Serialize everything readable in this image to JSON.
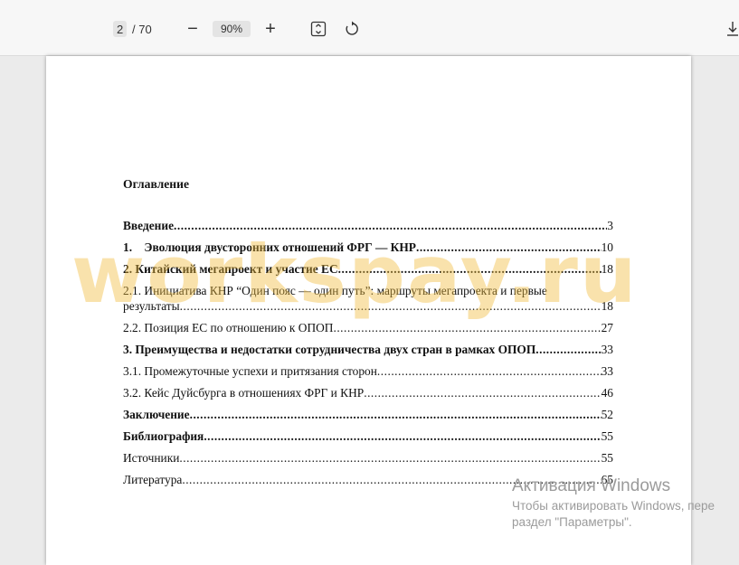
{
  "toolbar": {
    "current_page": "2",
    "total_pages": "/ 70",
    "zoom_out_glyph": "−",
    "zoom_level": "90%",
    "zoom_in_glyph": "+",
    "icons": [
      "fit-page-icon",
      "rotate-icon",
      "download-icon"
    ]
  },
  "document": {
    "heading": "Оглавление",
    "toc": [
      {
        "label": "Введение",
        "page": "3",
        "bold": true
      },
      {
        "label": "1.    Эволюция двусторонних отношений ФРГ — КНР",
        "page": "10",
        "bold": true
      },
      {
        "label": "2. Китайский мегапроект и участие ЕС",
        "page": "18",
        "bold": true
      },
      {
        "label_line1": "2.1. Инициатива КНР “Один пояс — один путь”: маршруты мегапроекта и первые",
        "label_line2": "результаты",
        "page": "18",
        "bold": false
      },
      {
        "label": "2.2. Позиция ЕС по отношению к ОПОП",
        "page": "27",
        "bold": false
      },
      {
        "label": "3. Преимущества и недостатки сотрудничества двух стран в рамках ОПОП",
        "page": "33",
        "bold": true
      },
      {
        "label": "3.1. Промежуточные успехи и притязания сторон",
        "page": "33",
        "bold": false
      },
      {
        "label": "3.2. Кейс Дуйсбурга в отношениях ФРГ и КНР",
        "page": "46",
        "bold": false
      },
      {
        "label": "Заключение",
        "page": "52",
        "bold": true
      },
      {
        "label": "Библиография",
        "page": "55",
        "bold": true
      },
      {
        "label": "Источники",
        "page": "55",
        "bold": false
      },
      {
        "label": "Литература",
        "page": "65",
        "bold": false
      }
    ]
  },
  "watermark": "workspay.ru",
  "activation": {
    "line1": "Активация Windows",
    "line2": "Чтобы активировать Windows, пере",
    "line3": "раздел \"Параметры\"."
  }
}
